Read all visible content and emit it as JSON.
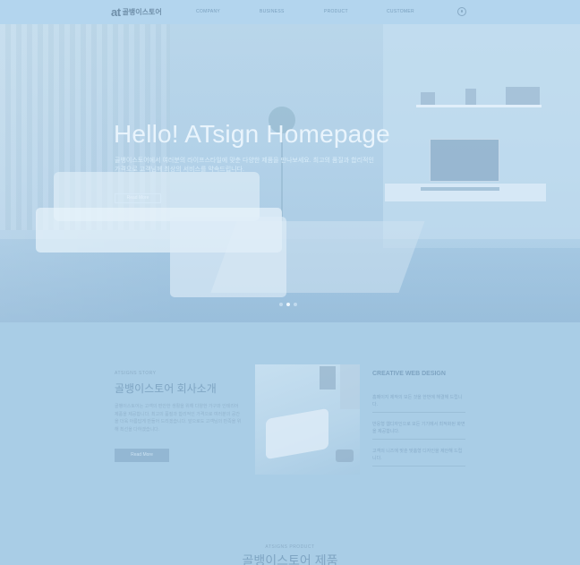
{
  "header": {
    "logo_mark": "at",
    "logo_text": "골뱅이스토어",
    "nav": [
      "COMPANY",
      "BUSINESS",
      "PRODUCT",
      "CUSTOMER"
    ],
    "user_icon": "user-icon"
  },
  "hero": {
    "title": "Hello! ATsign Homepage",
    "description": "골뱅이스토어에서 여러분의 라이프스타일에 맞춘 다양한 제품을 만나보세요. 최고의 품질과 합리적인 가격으로 고객님께 최상의 서비스를 약속드립니다.",
    "button": "Read More",
    "slide_count": 3,
    "active_slide": 1
  },
  "about": {
    "tag": "ATSIGNS STORY",
    "title": "골뱅이스토어 회사소개",
    "description": "골뱅이스토어는 고객의 편안한 생활을 위해 다양한 가구와 인테리어 제품을 제공합니다. 최고의 품질과 합리적인 가격으로 여러분의 공간을 더욱 아름답게 만들어 드리겠습니다. 앞으로도 고객님의 만족을 위해 최선을 다하겠습니다.",
    "button": "Read More"
  },
  "creative": {
    "title": "CREATIVE WEB DESIGN",
    "items": [
      "홈페이지 제작의 모든 것을 한번에 해결해 드립니다.",
      "반응형 웹디자인으로 모든 기기에서 최적화된 화면을 제공합니다.",
      "고객의 니즈에 맞춘 맞춤형 디자인을 제안해 드립니다."
    ]
  },
  "products": {
    "tag": "ATSIGNS PRODUCT",
    "title": "골뱅이스토어 제품"
  },
  "colors": {
    "page_bg": "#a9cde6",
    "header_bg": "#b3d5ee",
    "heading": "#7fa5c3"
  }
}
